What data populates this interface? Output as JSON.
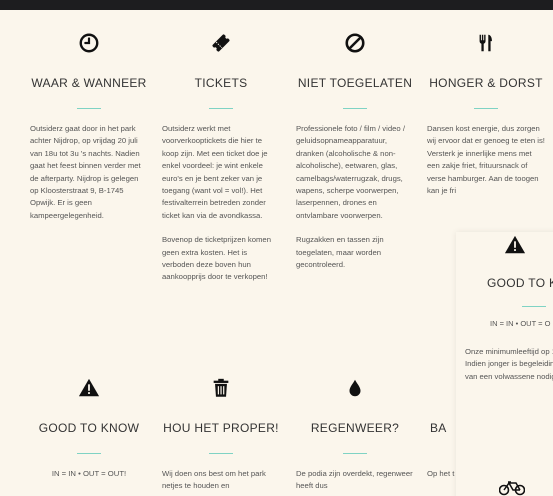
{
  "sections": {
    "waar": {
      "icon": "clock-icon",
      "title": "WAAR & WANNEER",
      "text": "Outsiderz gaat door in het park achter Nijdrop, op vrijdag 20 juli van 18u tot 3u 's nachts. Nadien gaat het feest binnen verder met de afterparty. Nijdrop is gelegen op Kloosterstraat 9, B-1745 Opwijk. Er is geen kampeergelegenheid."
    },
    "tickets": {
      "icon": "ticket-icon",
      "title": "TICKETS",
      "text1": "Outsiderz werkt met voorverkooptickets die hier te koop zijn. Met een ticket doe je enkel voordeel: je wint enkele euro's en je bent zeker van je toegang (want vol = vol!). Het festivalterrein betreden zonder ticket kan via de avondkassa.",
      "text2": "Bovenop de ticketprijzen komen geen extra kosten. Het is verboden deze boven hun aankoopprijs door te verkopen!"
    },
    "niet": {
      "icon": "prohibited-icon",
      "title": "NIET TOEGELATEN",
      "text1": "Professionele foto / film / video / geluidsopnameapparatuur, dranken (alcoholische & non-alcoholische), eetwaren, glas, camelbags/waterrugzak, drugs, wapens, scherpe voorwerpen, laserpennen, drones en ontvlambare voorwerpen.",
      "text2": "Rugzakken en tassen zijn toegelaten, maar worden gecontroleerd."
    },
    "honger": {
      "icon": "fork-knife-icon",
      "title": "HONGER & DORST",
      "text": "Dansen kost energie, dus zorgen wij ervoor dat er genoeg te eten is! Versterk je innerlijke mens met een zakje friet, frituursnack of verse hamburger. Aan de toogen kan je fri"
    },
    "good": {
      "icon": "warning-icon",
      "title": "GOOD TO KNOW",
      "text": "IN = IN • OUT = OUT!"
    },
    "proper": {
      "icon": "trash-icon",
      "title": "HOU HET PROPER!",
      "text": "Wij doen ons best om het park netjes te houden en"
    },
    "regen": {
      "icon": "drop-icon",
      "title": "REGENWEER?",
      "text": "De podia zijn overdekt, regenweer heeft dus"
    },
    "ba": {
      "title": "BA",
      "text": "Op het t met iets"
    }
  },
  "overlay": {
    "icon": "warning-icon",
    "title": "GOOD TO KN",
    "inout": "IN = IN • OUT = O",
    "text": "Onze minimumleeftijd op 14. Indien jonger is begeleiding van een volwassene nodig.",
    "bike_icon": "bicycle-icon"
  }
}
